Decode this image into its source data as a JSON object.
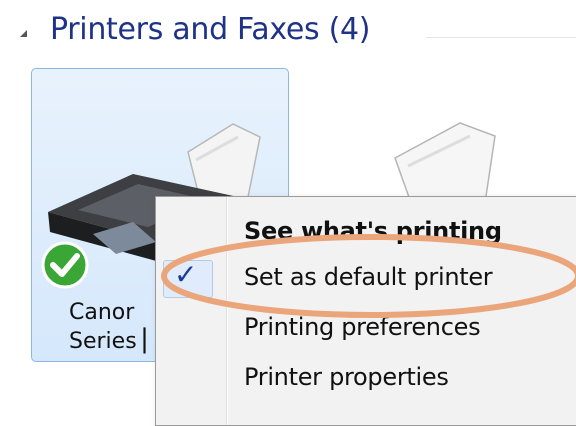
{
  "group": {
    "title": "Printers and Faxes (4)"
  },
  "printers": [
    {
      "label_line1": "Canor",
      "label_line2": "Series ▏"
    }
  ],
  "context_menu": {
    "items": [
      {
        "label": "See what's printing",
        "bold": true,
        "checked": false
      },
      {
        "label": "Set as default printer",
        "bold": false,
        "checked": true
      },
      {
        "label": "Printing preferences",
        "bold": false,
        "checked": false
      },
      {
        "label": "Printer properties",
        "bold": false,
        "checked": false
      }
    ],
    "check_glyph": "✓"
  },
  "colors": {
    "header_text": "#1e3287",
    "selection_tile": "#d5e8fb",
    "highlight_ring": "#eba57a",
    "check_accent": "#1c3a9a"
  }
}
